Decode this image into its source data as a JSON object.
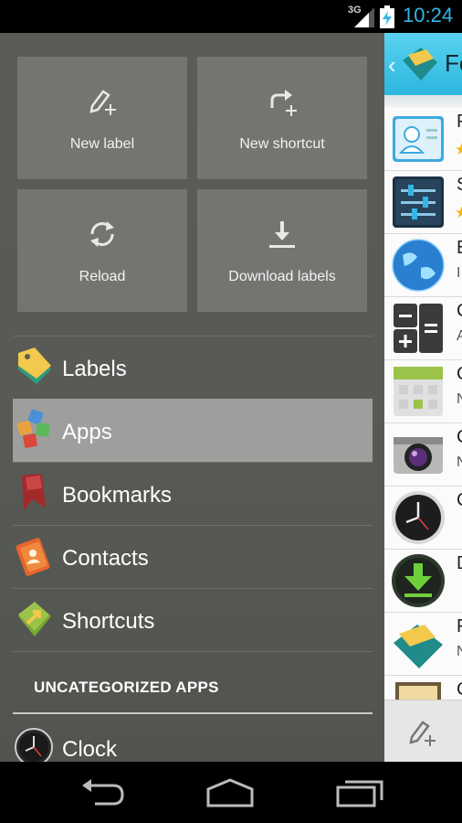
{
  "status_bar": {
    "network": "3G",
    "time": "10:24"
  },
  "drawer": {
    "tiles": [
      {
        "label": "New label",
        "icon": "new-label-icon"
      },
      {
        "label": "New shortcut",
        "icon": "new-shortcut-icon"
      },
      {
        "label": "Reload",
        "icon": "reload-icon"
      },
      {
        "label": "Download labels",
        "icon": "download-icon"
      }
    ],
    "nav_items": [
      {
        "label": "Labels",
        "icon": "labels-icon"
      },
      {
        "label": "Apps",
        "icon": "apps-icon",
        "selected": true
      },
      {
        "label": "Bookmarks",
        "icon": "bookmarks-icon"
      },
      {
        "label": "Contacts",
        "icon": "contacts-icon"
      },
      {
        "label": "Shortcuts",
        "icon": "shortcuts-icon"
      }
    ],
    "section_header": "UNCATEGORIZED APPS",
    "uncategorized": [
      {
        "label": "Clock",
        "icon": "clock-icon"
      }
    ]
  },
  "app_panel": {
    "title": "Fo",
    "rows": [
      {
        "name": "P",
        "icon": "contacts-app-icon",
        "starred": true
      },
      {
        "name": "S",
        "icon": "settings-app-icon",
        "starred": true
      },
      {
        "name": "B",
        "sub": "I",
        "icon": "browser-app-icon"
      },
      {
        "name": "C",
        "sub": "A",
        "icon": "calculator-app-icon"
      },
      {
        "name": "C",
        "sub": "N",
        "icon": "calendar-app-icon"
      },
      {
        "name": "C",
        "sub": "N",
        "icon": "camera-app-icon"
      },
      {
        "name": "C",
        "icon": "clock-app-icon"
      },
      {
        "name": "D",
        "icon": "downloads-app-icon"
      },
      {
        "name": "F",
        "sub": "N",
        "icon": "folder-organizer-app-icon"
      },
      {
        "name": "C",
        "icon": "gallery-app-icon"
      }
    ]
  },
  "colors": {
    "accent": "#33b5e5",
    "drawer_bg": "#575955",
    "tile_bg": "#737571",
    "selected_bg": "#9e9e9c"
  }
}
